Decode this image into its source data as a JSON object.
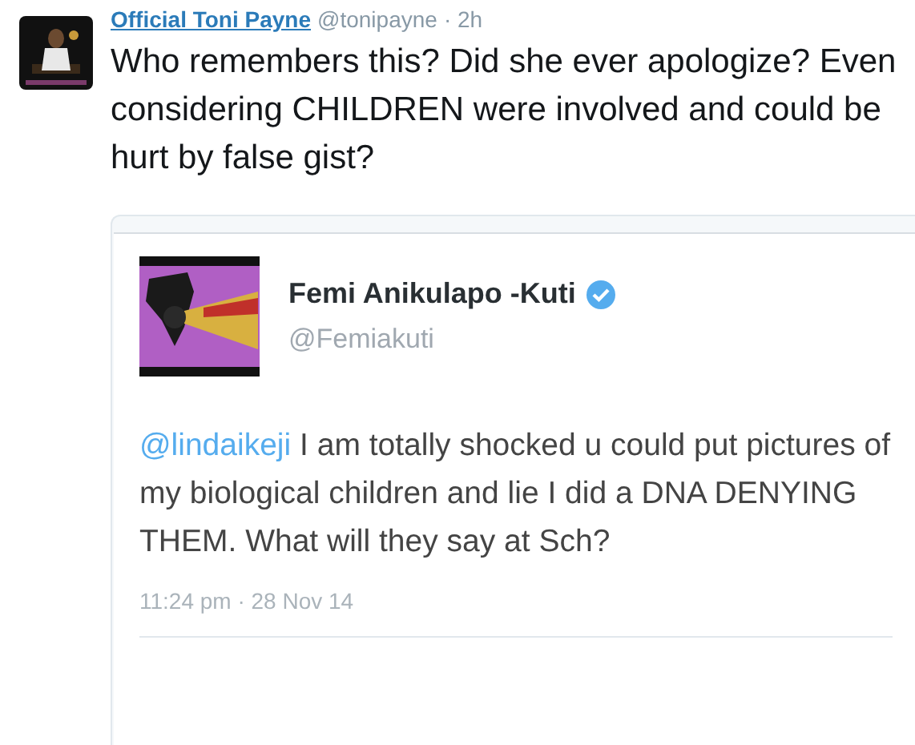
{
  "tweet": {
    "name": "Official Toni Payne",
    "handle": "@tonipayne",
    "time": "· 2h",
    "text": "Who remembers this? Did she ever apologize? Even considering CHILDREN were involved and could be hurt by false gist?"
  },
  "embedded": {
    "name": "Femi Anikulapo -Kuti",
    "verified": true,
    "handle": "@Femiakuti",
    "mention": "@lindaikeji",
    "text": " I am totally shocked u could put pictures of my biological children and lie I did a DNA DENYING THEM. What will they say at Sch?",
    "timestamp": "11:24 pm · 28 Nov 14"
  }
}
